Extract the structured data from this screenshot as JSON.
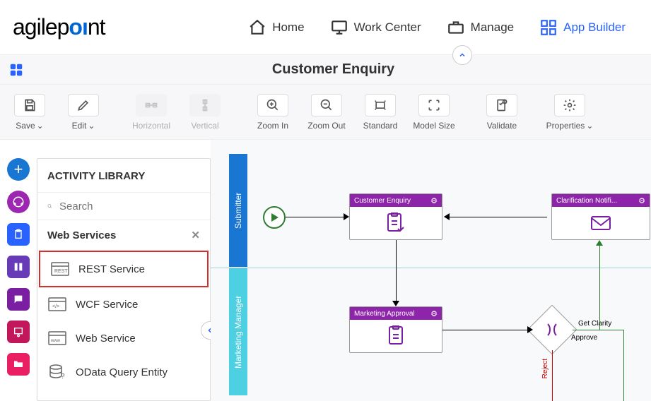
{
  "topnav": {
    "logo_pre": "agilep",
    "logo_oi": "oı",
    "logo_post": "nt",
    "items": [
      {
        "label": "Home"
      },
      {
        "label": "Work Center"
      },
      {
        "label": "Manage"
      },
      {
        "label": "App Builder"
      }
    ]
  },
  "titlebar": {
    "title": "Customer Enquiry"
  },
  "toolbar": {
    "save": "Save",
    "edit": "Edit",
    "horizontal": "Horizontal",
    "vertical": "Vertical",
    "zoom_in": "Zoom In",
    "zoom_out": "Zoom Out",
    "standard": "Standard",
    "model_size": "Model Size",
    "validate": "Validate",
    "properties": "Properties"
  },
  "sidebar": {
    "title": "ACTIVITY LIBRARY",
    "search_placeholder": "Search",
    "section": "Web Services",
    "items": [
      {
        "label": "REST Service"
      },
      {
        "label": "WCF Service"
      },
      {
        "label": "Web Service"
      },
      {
        "label": "OData Query Entity"
      }
    ]
  },
  "swimlanes": {
    "submitter": "Submitter",
    "marketing": "Marketing Manager"
  },
  "activities": {
    "customer_enquiry": "Customer Enquiry",
    "marketing_approval": "Marketing Approval",
    "clarification": "Clarification Notifi..."
  },
  "edges": {
    "reject": "Reject",
    "get_clarity": "Get Clarity",
    "approve": "Approve"
  }
}
